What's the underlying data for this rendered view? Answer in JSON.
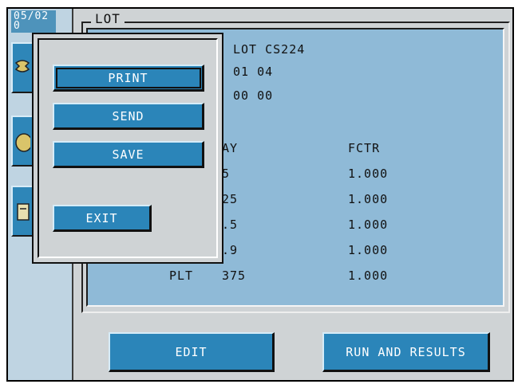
{
  "status": {
    "date": "05/02",
    "date_line2": "0"
  },
  "lot": {
    "frame_title": "LOT",
    "lot_label": "LOT CS224",
    "line1": "01 04",
    "line2": "00 00",
    "col_assay_header": "AY",
    "col_fctr_header": "FCTR",
    "rows": [
      {
        "label": "",
        "assay": "5",
        "fctr": "1.000"
      },
      {
        "label": "",
        "assay": "25",
        "fctr": "1.000"
      },
      {
        "label": "",
        "assay": ".5",
        "fctr": "1.000"
      },
      {
        "label": "",
        "assay": ".9",
        "fctr": "1.000"
      },
      {
        "label": "PLT",
        "assay": "375",
        "fctr": "1.000"
      }
    ]
  },
  "popup": {
    "print_label": "PRINT",
    "send_label": "SEND",
    "save_label": "SAVE",
    "exit_label": "EXIT"
  },
  "footer": {
    "edit_label": "EDIT",
    "run_label": "RUN AND RESULTS"
  },
  "colors": {
    "button": "#2b85b9",
    "panel": "#8fbad7",
    "sidebar": "#bfd4e2",
    "background": "#cfd3d5"
  },
  "icons": [
    "wrench-icon",
    "flask-icon",
    "document-icon"
  ]
}
